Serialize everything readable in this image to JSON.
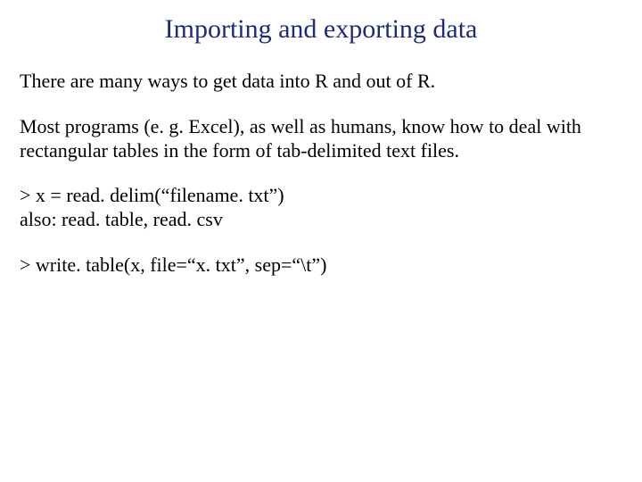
{
  "title": "Importing and exporting data",
  "paragraphs": {
    "p1": "There are many ways to get data into R and out of R.",
    "p2": "Most programs (e. g. Excel), as well as humans, know how to deal with rectangular tables in the form of tab-delimited text files.",
    "c1": "> x = read. delim(“filename. txt”)",
    "c2": "also: read. table, read. csv",
    "c3": "> write. table(x, file=“x. txt”, sep=“\\t”)"
  }
}
